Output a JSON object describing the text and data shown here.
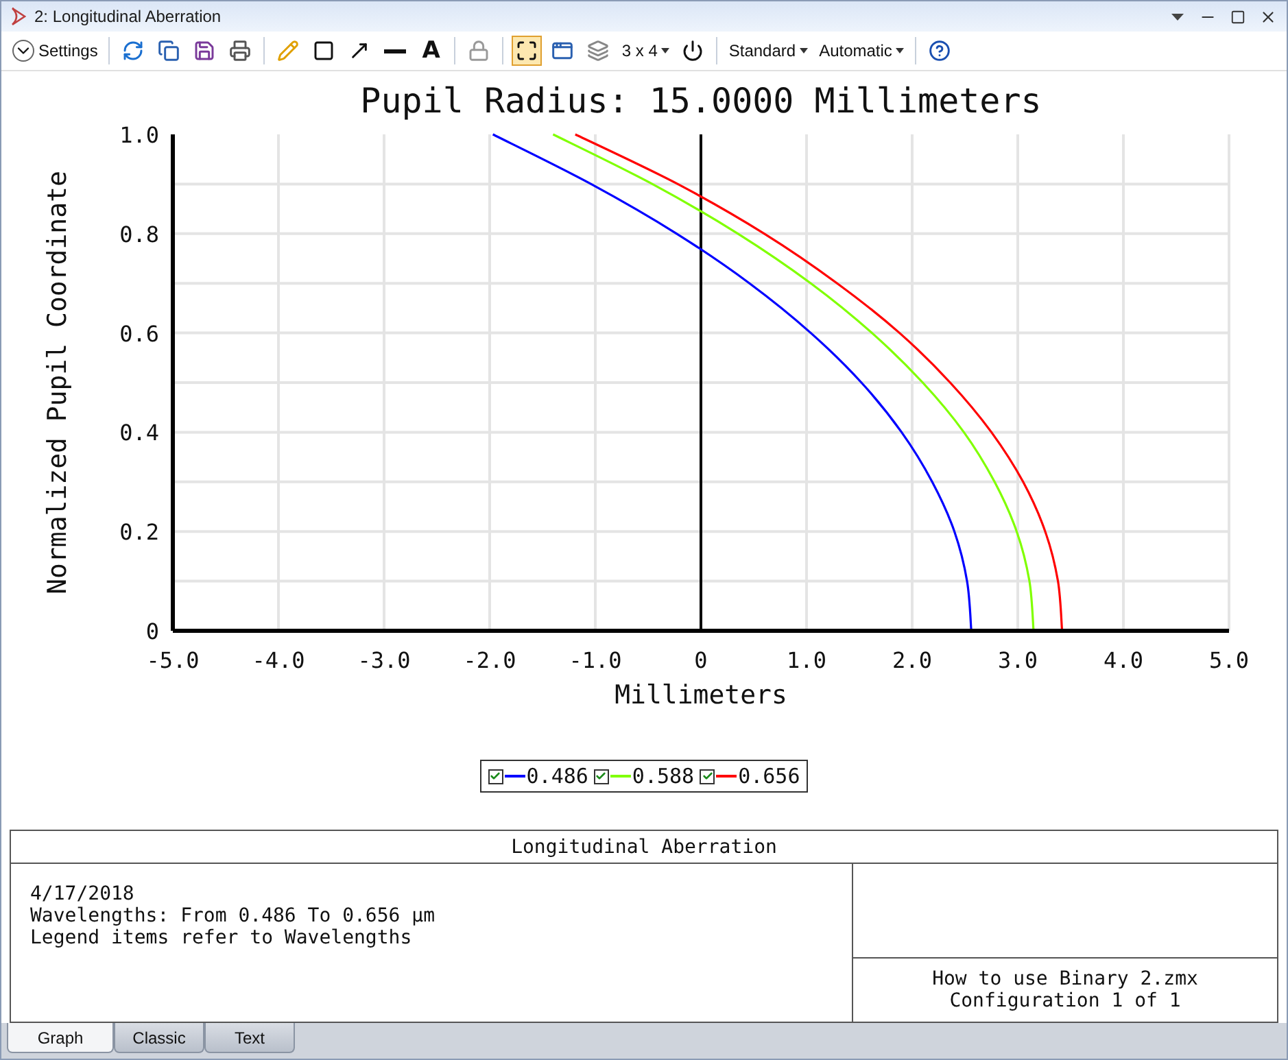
{
  "window": {
    "title": "2: Longitudinal Aberration"
  },
  "toolbar": [
    {
      "kind": "settings",
      "label": "Settings"
    },
    {
      "kind": "separator"
    },
    {
      "kind": "refresh",
      "selected": false
    },
    {
      "kind": "copy",
      "selected": false
    },
    {
      "kind": "save",
      "selected": false
    },
    {
      "kind": "print",
      "selected": false
    },
    {
      "kind": "separator"
    },
    {
      "kind": "pencil",
      "selected": false
    },
    {
      "kind": "rectangle",
      "selected": false
    },
    {
      "kind": "arrow",
      "selected": false
    },
    {
      "kind": "line",
      "selected": false
    },
    {
      "kind": "text",
      "label": "A",
      "selected": false
    },
    {
      "kind": "separator"
    },
    {
      "kind": "lock",
      "selected": false
    },
    {
      "kind": "separator"
    },
    {
      "kind": "fit",
      "selected": true
    },
    {
      "kind": "window",
      "selected": false
    },
    {
      "kind": "layers",
      "selected": false
    },
    {
      "kind": "dropdown",
      "label": "3 x 4"
    },
    {
      "kind": "power",
      "selected": false
    },
    {
      "kind": "separator"
    },
    {
      "kind": "dropdown",
      "label": "Standard"
    },
    {
      "kind": "dropdown",
      "label": "Automatic"
    },
    {
      "kind": "separator"
    },
    {
      "kind": "help",
      "selected": false
    }
  ],
  "chart": {
    "chart_data": {
      "type": "line",
      "title": "Pupil Radius: 15.0000 Millimeters",
      "xlabel": "Millimeters",
      "ylabel": "Normalized Pupil Coordinate",
      "orientation": "horizontal",
      "x": [
        0,
        0.1,
        0.2,
        0.3,
        0.4,
        0.5,
        0.6,
        0.7,
        0.8,
        0.9,
        1.0
      ],
      "series": [
        {
          "name": "0.486",
          "color": "#0000ff",
          "values": [
            2.56,
            2.52,
            2.4,
            2.19,
            1.9,
            1.52,
            1.04,
            0.46,
            -0.23,
            -1.04,
            -1.97
          ]
        },
        {
          "name": "0.588",
          "color": "#80ff00",
          "values": [
            3.15,
            3.11,
            2.99,
            2.78,
            2.49,
            2.1,
            1.62,
            1.04,
            0.35,
            -0.46,
            -1.4
          ]
        },
        {
          "name": "0.656",
          "color": "#ff0000",
          "values": [
            3.42,
            3.38,
            3.26,
            3.05,
            2.75,
            2.36,
            1.88,
            1.29,
            0.6,
            -0.22,
            -1.19
          ]
        }
      ],
      "xlim": [
        -5,
        5
      ],
      "ylim": [
        0,
        1
      ],
      "grid": true,
      "xticks": [
        {
          "value": -5,
          "label": "-5.0"
        },
        {
          "value": -4,
          "label": "-4.0"
        },
        {
          "value": -3,
          "label": "-3.0"
        },
        {
          "value": -2,
          "label": "-2.0"
        },
        {
          "value": -1,
          "label": "-1.0"
        },
        {
          "value": 0,
          "label": "0"
        },
        {
          "value": 1,
          "label": "1.0"
        },
        {
          "value": 2,
          "label": "2.0"
        },
        {
          "value": 3,
          "label": "3.0"
        },
        {
          "value": 4,
          "label": "4.0"
        },
        {
          "value": 5,
          "label": "5.0"
        }
      ],
      "yticks": [
        {
          "value": 0,
          "label": "0"
        },
        {
          "value": 0.2,
          "label": "0.2"
        },
        {
          "value": 0.4,
          "label": "0.4"
        },
        {
          "value": 0.6,
          "label": "0.6"
        },
        {
          "value": 0.8,
          "label": "0.8"
        },
        {
          "value": 1,
          "label": "1.0"
        }
      ]
    }
  },
  "legend": [
    {
      "checked": true
    },
    {
      "checked": true
    },
    {
      "checked": true
    }
  ],
  "info": {
    "title": "Longitudinal Aberration",
    "lines": [
      "4/17/2018",
      "Wavelengths: From 0.486 To 0.656 µm",
      "Legend items refer to Wavelengths"
    ],
    "file_lines": [
      "How to use Binary 2.zmx",
      "Configuration 1 of 1"
    ]
  },
  "tabs": [
    {
      "label": "Graph",
      "selected": true
    },
    {
      "label": "Classic",
      "selected": false
    },
    {
      "label": "Text",
      "selected": false
    }
  ]
}
